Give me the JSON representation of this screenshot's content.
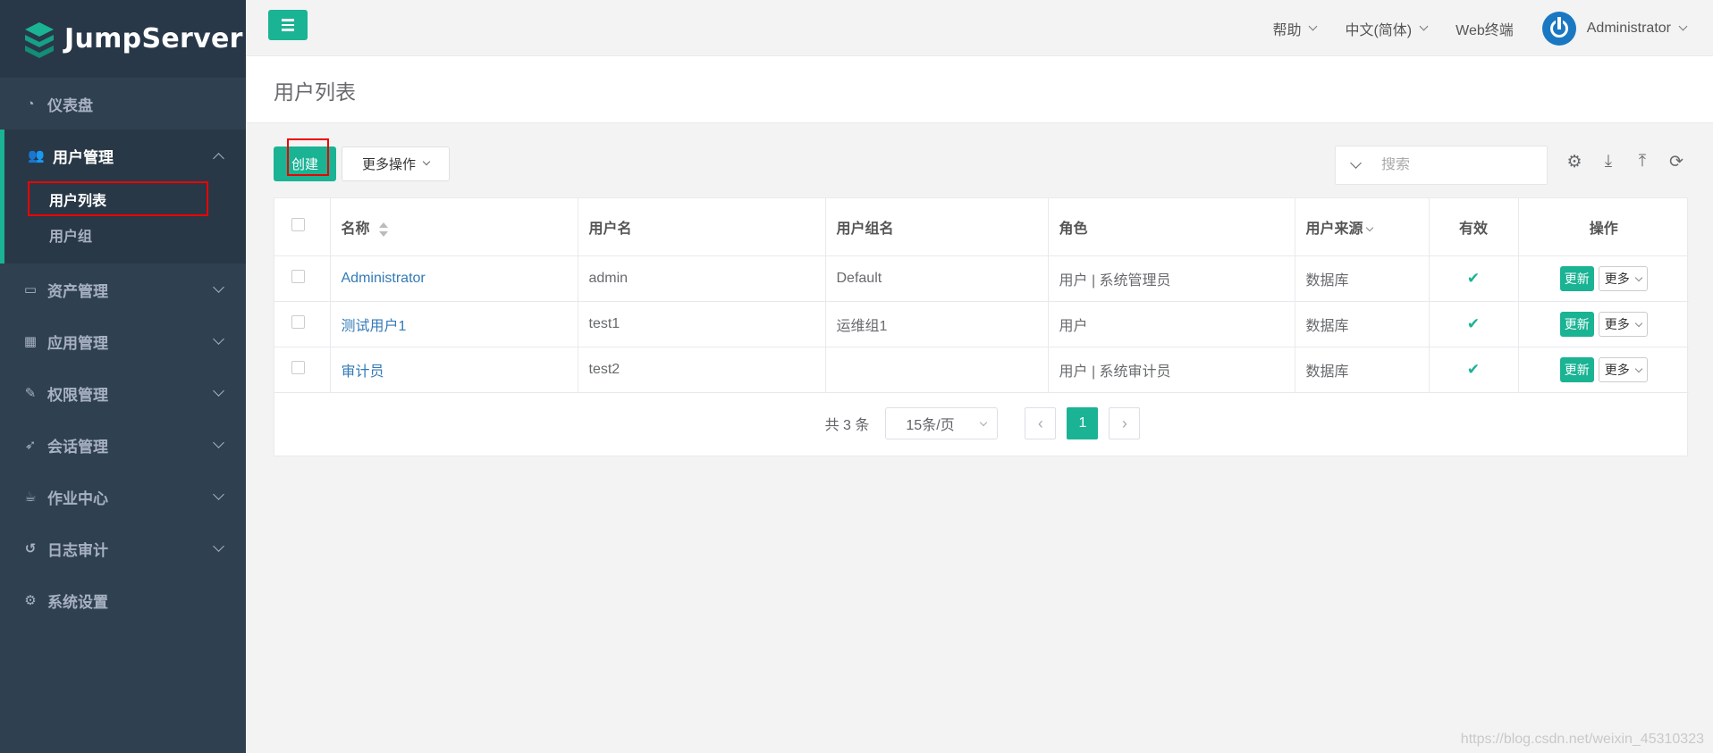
{
  "app": {
    "logo_text": "JumpServer"
  },
  "sidebar": {
    "items": [
      {
        "label": "仪表盘",
        "icon": "dashboard-icon"
      },
      {
        "label": "用户管理",
        "icon": "users-icon"
      },
      {
        "label": "资产管理",
        "icon": "inbox-icon"
      },
      {
        "label": "应用管理",
        "icon": "grid-icon"
      },
      {
        "label": "权限管理",
        "icon": "edit-icon"
      },
      {
        "label": "会话管理",
        "icon": "rocket-icon"
      },
      {
        "label": "作业中心",
        "icon": "coffee-icon"
      },
      {
        "label": "日志审计",
        "icon": "history-icon"
      },
      {
        "label": "系统设置",
        "icon": "cogs-icon"
      }
    ],
    "sub_items": [
      {
        "label": "用户列表"
      },
      {
        "label": "用户组"
      }
    ]
  },
  "topbar": {
    "help": "帮助",
    "language": "中文(简体)",
    "web_terminal": "Web终端",
    "user": "Administrator"
  },
  "page": {
    "title": "用户列表"
  },
  "toolbar": {
    "create_label": "创建",
    "more_actions_label": "更多操作",
    "search_placeholder": "搜索"
  },
  "table": {
    "headers": {
      "name": "名称",
      "username": "用户名",
      "group": "用户组名",
      "role": "角色",
      "source": "用户来源",
      "active": "有效",
      "actions": "操作"
    },
    "rows": [
      {
        "name": "Administrator",
        "username": "admin",
        "group": "Default",
        "role": "用户 | 系统管理员",
        "source": "数据库",
        "active": true,
        "update": "更新",
        "more": "更多"
      },
      {
        "name": "测试用户1",
        "username": "test1",
        "group": "运维组1",
        "role": "用户",
        "source": "数据库",
        "active": true,
        "update": "更新",
        "more": "更多"
      },
      {
        "name": "审计员",
        "username": "test2",
        "group": "",
        "role": "用户 | 系统审计员",
        "source": "数据库",
        "active": true,
        "update": "更新",
        "more": "更多"
      }
    ]
  },
  "pagination": {
    "total": "共 3 条",
    "page_size": "15条/页",
    "current_page": "1"
  },
  "watermark": "https://blog.csdn.net/weixin_45310323",
  "colors": {
    "accent": "#1ab394",
    "sidebar": "#2f4050",
    "link": "#337ab7",
    "highlight": "#e00000"
  }
}
